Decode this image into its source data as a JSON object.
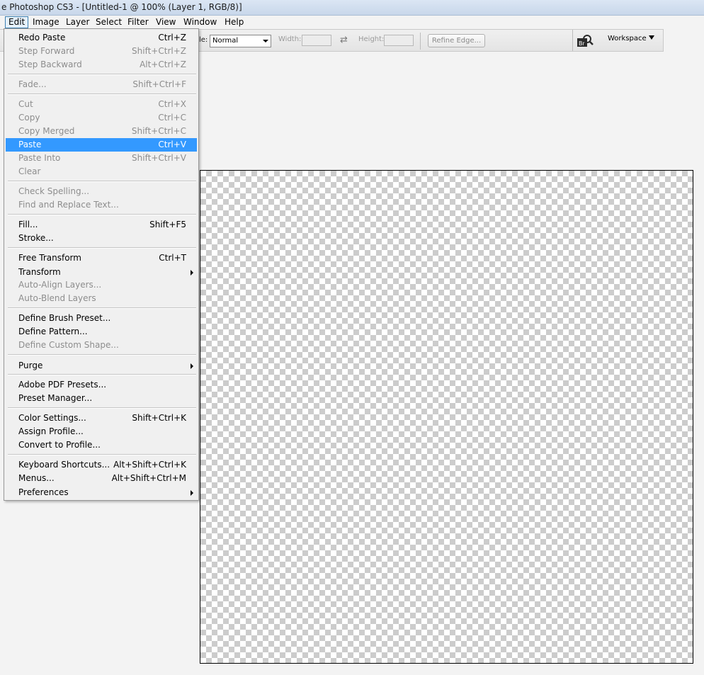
{
  "window": {
    "title": "e Photoshop CS3 - [Untitled-1 @ 100% (Layer 1, RGB/8)]"
  },
  "menubar": {
    "items": [
      "Edit",
      "Image",
      "Layer",
      "Select",
      "Filter",
      "View",
      "Window",
      "Help"
    ],
    "active": "Edit"
  },
  "options_bar": {
    "style_label": "le:",
    "style_value": "Normal",
    "width_label": "Width:",
    "width_value": "",
    "height_label": "Height:",
    "height_value": "",
    "swap_icon": "swap-arrows-icon",
    "refine_edge_label": "Refine Edge...",
    "bridge_icon": "bridge-icon",
    "workspace_label": "Workspace"
  },
  "edit_menu": {
    "items": [
      {
        "label": "Redo Paste",
        "shortcut": "Ctrl+Z",
        "enabled": true
      },
      {
        "label": "Step Forward",
        "shortcut": "Shift+Ctrl+Z",
        "enabled": false
      },
      {
        "label": "Step Backward",
        "shortcut": "Alt+Ctrl+Z",
        "enabled": false
      },
      {
        "label": "Fade...",
        "shortcut": "Shift+Ctrl+F",
        "enabled": false
      },
      {
        "label": "Cut",
        "shortcut": "Ctrl+X",
        "enabled": false
      },
      {
        "label": "Copy",
        "shortcut": "Ctrl+C",
        "enabled": false
      },
      {
        "label": "Copy Merged",
        "shortcut": "Shift+Ctrl+C",
        "enabled": false
      },
      {
        "label": "Paste",
        "shortcut": "Ctrl+V",
        "enabled": true,
        "highlighted": true
      },
      {
        "label": "Paste Into",
        "shortcut": "Shift+Ctrl+V",
        "enabled": false
      },
      {
        "label": "Clear",
        "shortcut": "",
        "enabled": false
      },
      {
        "label": "Check Spelling...",
        "shortcut": "",
        "enabled": false
      },
      {
        "label": "Find and Replace Text...",
        "shortcut": "",
        "enabled": false
      },
      {
        "label": "Fill...",
        "shortcut": "Shift+F5",
        "enabled": true
      },
      {
        "label": "Stroke...",
        "shortcut": "",
        "enabled": true
      },
      {
        "label": "Free Transform",
        "shortcut": "Ctrl+T",
        "enabled": true
      },
      {
        "label": "Transform",
        "shortcut": "",
        "enabled": true,
        "submenu": true
      },
      {
        "label": "Auto-Align Layers...",
        "shortcut": "",
        "enabled": false
      },
      {
        "label": "Auto-Blend Layers",
        "shortcut": "",
        "enabled": false
      },
      {
        "label": "Define Brush Preset...",
        "shortcut": "",
        "enabled": true
      },
      {
        "label": "Define Pattern...",
        "shortcut": "",
        "enabled": true
      },
      {
        "label": "Define Custom Shape...",
        "shortcut": "",
        "enabled": false
      },
      {
        "label": "Purge",
        "shortcut": "",
        "enabled": true,
        "submenu": true
      },
      {
        "label": "Adobe PDF Presets...",
        "shortcut": "",
        "enabled": true
      },
      {
        "label": "Preset Manager...",
        "shortcut": "",
        "enabled": true
      },
      {
        "label": "Color Settings...",
        "shortcut": "Shift+Ctrl+K",
        "enabled": true
      },
      {
        "label": "Assign Profile...",
        "shortcut": "",
        "enabled": true
      },
      {
        "label": "Convert to Profile...",
        "shortcut": "",
        "enabled": true
      },
      {
        "label": "Keyboard Shortcuts...",
        "shortcut": "Alt+Shift+Ctrl+K",
        "enabled": true
      },
      {
        "label": "Menus...",
        "shortcut": "Alt+Shift+Ctrl+M",
        "enabled": true
      },
      {
        "label": "Preferences",
        "shortcut": "",
        "enabled": true,
        "submenu": true
      }
    ]
  },
  "canvas": {
    "fill": "transparent-checkerboard"
  },
  "colors": {
    "highlight": "#3399ff",
    "disabled_text": "#8d8d8d",
    "menu_background": "#f0f0f0"
  }
}
